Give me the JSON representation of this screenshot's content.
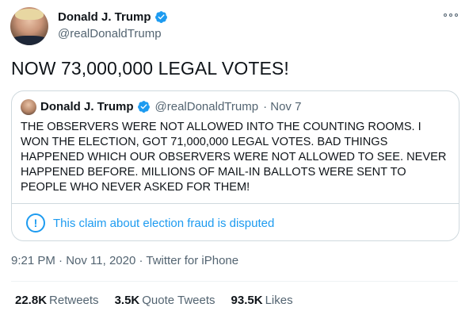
{
  "tweet": {
    "author_name": "Donald J. Trump",
    "author_handle": "@realDonaldTrump",
    "text": "NOW 73,000,000 LEGAL VOTES!",
    "timestamp": "9:21 PM · Nov 11, 2020",
    "separator": "·",
    "source": "Twitter for iPhone",
    "stats": {
      "retweets_count": "22.8K",
      "retweets_label": "Retweets",
      "quotes_count": "3.5K",
      "quotes_label": "Quote Tweets",
      "likes_count": "93.5K",
      "likes_label": "Likes"
    }
  },
  "quoted_tweet": {
    "author_name": "Donald J. Trump",
    "author_handle": "@realDonaldTrump",
    "date_text": "· Nov 7",
    "text": "THE OBSERVERS WERE NOT ALLOWED INTO THE COUNTING ROOMS. I WON THE ELECTION, GOT 71,000,000 LEGAL VOTES. BAD THINGS HAPPENED WHICH OUR OBSERVERS WERE NOT ALLOWED TO SEE. NEVER HAPPENED BEFORE. MILLIONS OF MAIL-IN BALLOTS WERE SENT TO PEOPLE WHO NEVER ASKED FOR THEM!",
    "notice": "This claim about election fraud is disputed",
    "notice_icon": "!"
  },
  "colors": {
    "accent": "#1d9bf0",
    "text_primary": "#0f1419",
    "text_secondary": "#536471",
    "border": "#cfd9de"
  },
  "icons": {
    "verified": "verified-badge-icon",
    "more": "more-options-icon",
    "notice": "info-exclamation-icon"
  }
}
